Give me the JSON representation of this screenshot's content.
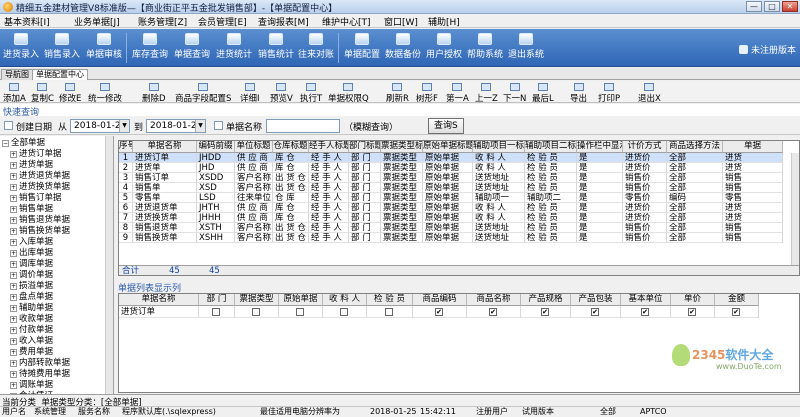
{
  "window": {
    "title": "精细五金建材管理V8标准版—【商业街正平五金批发销售部】-【单据配置中心】",
    "controls": [
      "—",
      "□",
      "✕"
    ]
  },
  "menu": [
    "基本资料[I]",
    "业务单据[J]",
    "账务管理[Z]",
    "会员管理[E]",
    "查询报表[M]",
    "维护中心[T]",
    "窗口[W]",
    "辅助[H]"
  ],
  "toolbar": {
    "buttons": [
      "进货录入",
      "销售录入",
      "单据审核",
      "库存查询",
      "单据查询",
      "进货统计",
      "销售统计",
      "往来对账",
      "单据配置",
      "数据备份",
      "用户授权",
      "帮助系统",
      "退出系统"
    ],
    "user": "未注册版本"
  },
  "tabs": [
    "导航图",
    "单据配置中心"
  ],
  "toolbar2": {
    "buttons": [
      "添加A",
      "复制C",
      "修改E",
      "统一修改",
      "删除D",
      "商品字段配置S",
      "详细I",
      "预览V",
      "执行T",
      "单据权限Q",
      "刷新R",
      "树形F",
      "第一A",
      "上一Z",
      "下一N",
      "最后L",
      "导出",
      "打印P",
      "退出X"
    ]
  },
  "query": {
    "section_title": "快速查询",
    "create_date_label": "创建日期",
    "from_label": "从",
    "date_from": "2018-01-25",
    "to_label": "到",
    "date_to": "2018-01-25",
    "doc_name_label": "单据名称",
    "fuzzy_label": "（模糊查询）",
    "query_button": "查询S"
  },
  "tree": {
    "root": "全部单据",
    "items": [
      "进货订单据",
      "进货单据",
      "进货退货单据",
      "进货换货单据",
      "销售订单据",
      "销售单据",
      "销售退货单据",
      "销售换货单据",
      "入库单据",
      "出库单据",
      "调库单据",
      "调价单据",
      "损溢单据",
      "盘点单据",
      "辅助单据",
      "收款单据",
      "付款单据",
      "收入单据",
      "费用单据",
      "内部转款单据",
      "待摊费用单据",
      "调账单据",
      "会计凭证"
    ]
  },
  "grid": {
    "headers": [
      "序号",
      "单据名称",
      "编码前缀",
      "单位标题",
      "仓库标题",
      "经手人标题",
      "部门标题",
      "票据类型标题",
      "原始单据标题",
      "辅助项目一标题",
      "辅助项目二标题",
      "操作栏中显示",
      "计价方式",
      "商品选择方法",
      "单据"
    ],
    "rows": [
      [
        "1",
        "进货订单",
        "JHDD",
        "供 应 商",
        "库    仓",
        "经 手 人",
        "部    门",
        "票据类型",
        "原始单据",
        "收 料 人",
        "检 验 员",
        "是",
        "进货价",
        "全部",
        "进货"
      ],
      [
        "2",
        "进货单",
        "JHD",
        "供 应 商",
        "库    仓",
        "经 手 人",
        "部    门",
        "票据类型",
        "原始单据",
        "收 料 人",
        "检 验 员",
        "是",
        "进货价",
        "全部",
        "进货"
      ],
      [
        "3",
        "销售订单",
        "XSDD",
        "客户名称",
        "出 货 仓",
        "经 手 人",
        "部    门",
        "票据类型",
        "原始单据",
        "送货地址",
        "检 验 员",
        "是",
        "销售价",
        "全部",
        "销售"
      ],
      [
        "4",
        "销售单",
        "XSD",
        "客户名称",
        "出 货 仓",
        "经 手 人",
        "部    门",
        "票据类型",
        "原始单据",
        "送货地址",
        "检 验 员",
        "是",
        "销售价",
        "全部",
        "销售"
      ],
      [
        "5",
        "零售单",
        "LSD",
        "往来单位",
        "仓    库",
        "经 手 人",
        "部    门",
        "票据类型",
        "原始单据",
        "辅助项一",
        "辅助项二",
        "是",
        "零售价",
        "编码",
        "零售"
      ],
      [
        "6",
        "进货退货单",
        "JHTH",
        "供 应 商",
        "库    仓",
        "经 手 人",
        "部    门",
        "票据类型",
        "原始单据",
        "收 料 人",
        "检 验 员",
        "是",
        "进货价",
        "全部",
        "进货"
      ],
      [
        "7",
        "进货换货单",
        "JHHH",
        "供 应 商",
        "库    仓",
        "经 手 人",
        "部    门",
        "票据类型",
        "原始单据",
        "收 料 人",
        "检 验 员",
        "是",
        "进货价",
        "全部",
        "进货"
      ],
      [
        "8",
        "销售退货单",
        "XSTH",
        "客户名称",
        "出 货 仓",
        "经 手 人",
        "部    门",
        "票据类型",
        "原始单据",
        "送货地址",
        "检 验 员",
        "是",
        "销售价",
        "全部",
        "销售"
      ],
      [
        "9",
        "销售换货单",
        "XSHH",
        "客户名称",
        "出 货 仓",
        "经 手 人",
        "部    门",
        "票据类型",
        "原始单据",
        "送货地址",
        "检 验 员",
        "是",
        "销售价",
        "全部",
        "销售"
      ]
    ],
    "total_label": "合计",
    "total_a": "45",
    "total_b": "45"
  },
  "list_section": {
    "title": "单据列表显示列",
    "headers": [
      "单据名称",
      "部    门",
      "票据类型",
      "原始单据",
      "收 料 人",
      "检 验 员",
      "商品编码",
      "商品名称",
      "产品规格",
      "产品包装",
      "基本单位",
      "单价",
      "金额"
    ],
    "row_name": "进货订单",
    "checkmark": "✔"
  },
  "status": {
    "line1_a": "当前分类",
    "line1_b": "单据类型分类：[全部单据]",
    "line2": [
      "用户名",
      "系统管理",
      "服务名称",
      "程序默认库(.\\sqlexpress)",
      "最佳适用电脑分辨率为",
      "2018-01-25",
      "15:42:11",
      "注册用户",
      "试用版本",
      "全部",
      "APTCO"
    ]
  },
  "watermark": {
    "brand_a": "2345",
    "brand_b": "软件大全",
    "url": "www.DuoTe.com"
  },
  "colors": {
    "toolbar_blue": "#2f66b6",
    "section_title": "#2a5aa8",
    "selected_row": "#cfe0fa"
  }
}
